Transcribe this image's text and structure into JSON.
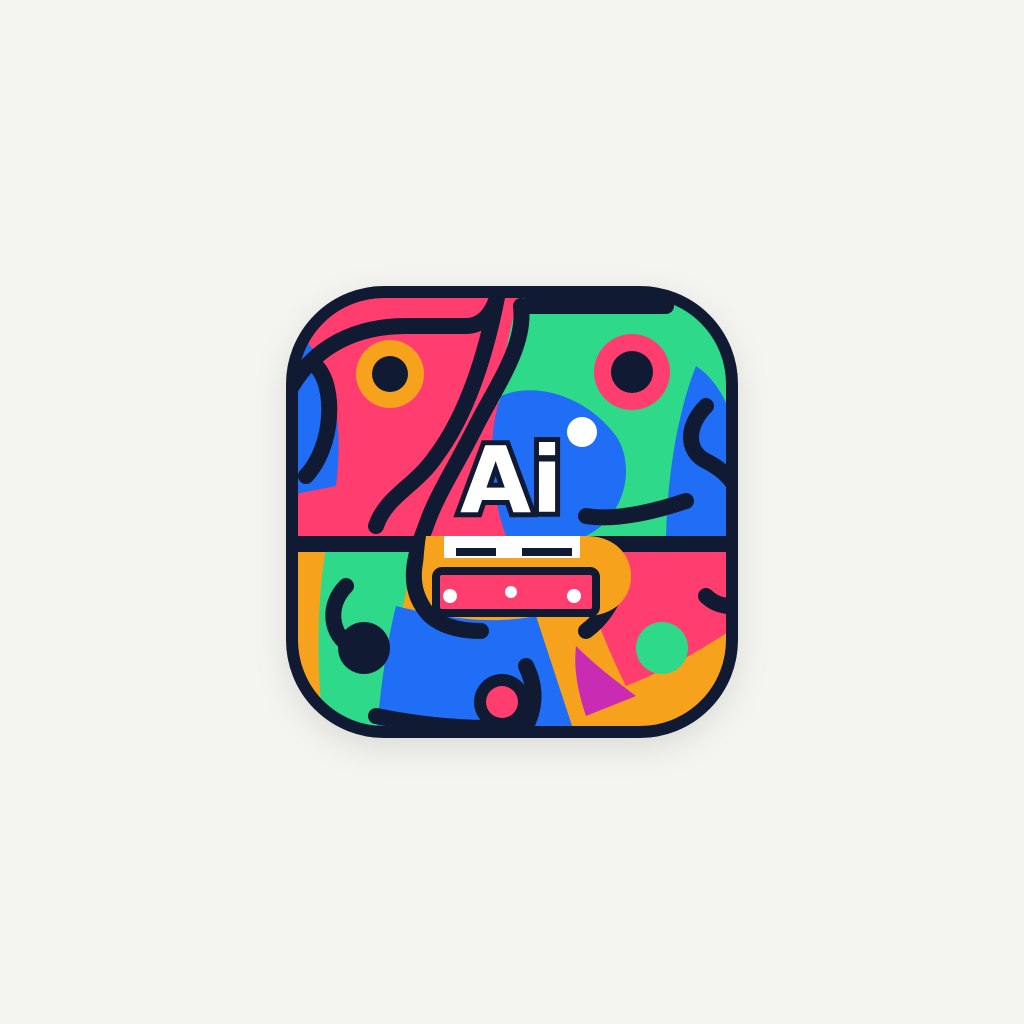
{
  "icon": {
    "name": "ai-app-icon",
    "glyph_text": "Ai",
    "colors": {
      "background": "#f4f5f1",
      "outline": "#111a33",
      "pink": "#ff3d6e",
      "green": "#2ed98a",
      "blue": "#1f6ef5",
      "orange": "#f7a21d",
      "magenta": "#c92bb3",
      "white": "#ffffff"
    }
  }
}
